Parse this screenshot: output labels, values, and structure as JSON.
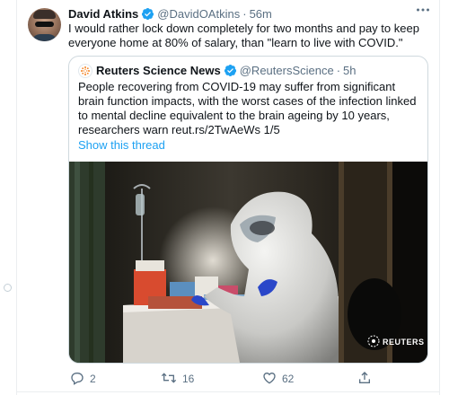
{
  "tweet": {
    "author_name": "David Atkins",
    "author_handle": "@DavidOAtkins",
    "separator": "·",
    "timestamp": "56m",
    "text": "I would rather lock down completely for two months and pay to keep everyone home at 80% of salary, than \"learn to live with COVID.\""
  },
  "quote": {
    "author_name": "Reuters Science News",
    "author_handle": "@ReutersScience",
    "separator": "·",
    "timestamp": "5h",
    "text": "People recovering from COVID-19 may suffer from significant brain function impacts, with the worst cases of the infection linked to mental decline equivalent to the brain ageing by 10 years, researchers warn reut.rs/2TwAeWs 1/5",
    "show_thread_label": "Show this thread",
    "media_watermark": "REUTERS"
  },
  "actions": {
    "reply_count": "2",
    "retweet_count": "16",
    "like_count": "62"
  },
  "colors": {
    "accent": "#1da1f2",
    "secondary_text": "#5b7083",
    "border": "#cfd9de"
  },
  "icons": [
    "verified-badge-icon",
    "more-icon",
    "reply-icon",
    "retweet-icon",
    "like-icon",
    "share-icon"
  ]
}
